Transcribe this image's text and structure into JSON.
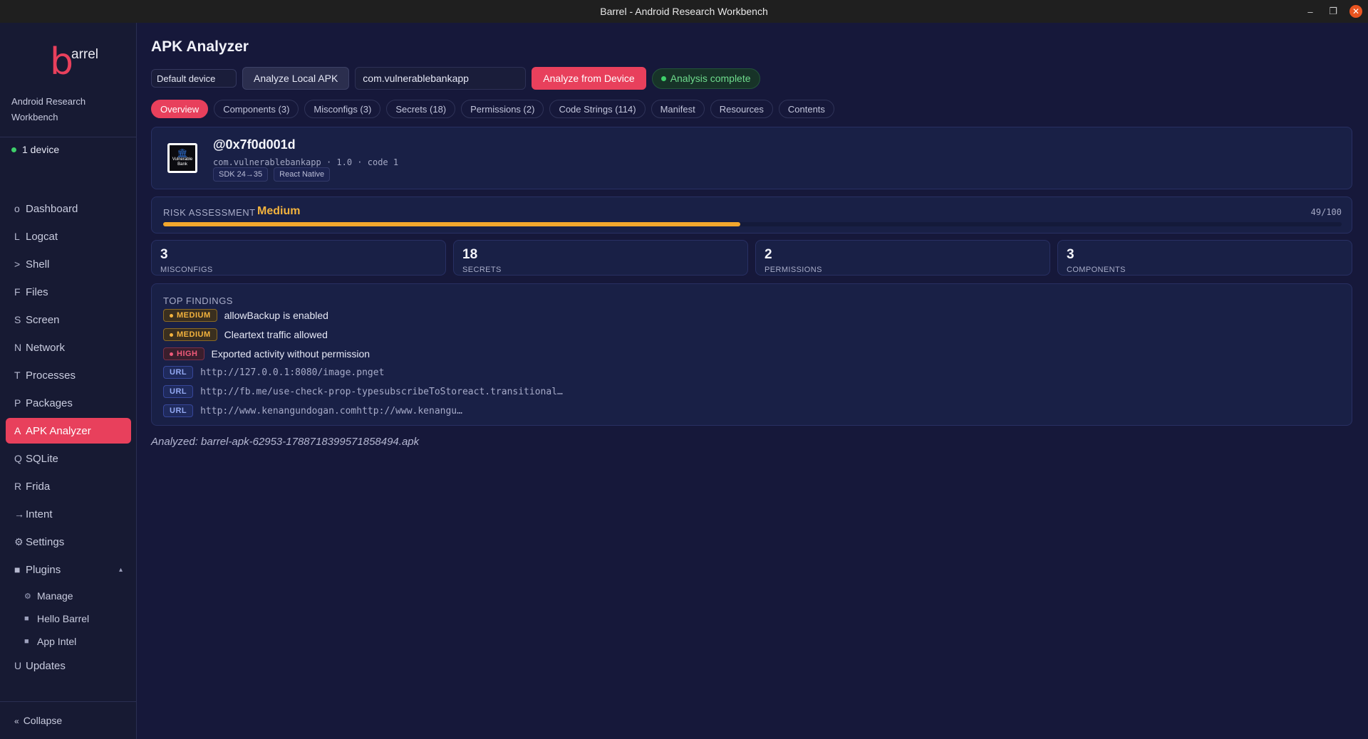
{
  "window": {
    "title": "Barrel - Android Research Workbench",
    "controls": {
      "minimize": "–",
      "restore": "❐",
      "close": "✕"
    }
  },
  "sidebar": {
    "logo_b": "b",
    "logo_text": "arrel",
    "subtitle": "Android Research Workbench",
    "device_status": "1 device",
    "nav": [
      {
        "key": "o",
        "label": "Dashboard"
      },
      {
        "key": "L",
        "label": "Logcat"
      },
      {
        "key": ">",
        "label": "Shell"
      },
      {
        "key": "F",
        "label": "Files"
      },
      {
        "key": "S",
        "label": "Screen"
      },
      {
        "key": "N",
        "label": "Network"
      },
      {
        "key": "T",
        "label": "Processes"
      },
      {
        "key": "P",
        "label": "Packages"
      },
      {
        "key": "A",
        "label": "APK Analyzer"
      },
      {
        "key": "Q",
        "label": "SQLite"
      },
      {
        "key": "R",
        "label": "Frida"
      },
      {
        "key": "→",
        "label": "Intent"
      },
      {
        "key": "⚙",
        "label": "Settings"
      },
      {
        "key": "■",
        "label": "Plugins",
        "caret": "▴"
      }
    ],
    "plugins": [
      {
        "key": "⚙",
        "label": "Manage"
      },
      {
        "key": "■",
        "label": "Hello Barrel"
      },
      {
        "key": "■",
        "label": "App Intel"
      }
    ],
    "updates": {
      "key": "U",
      "label": "Updates"
    },
    "collapse": {
      "key": "«",
      "label": "Collapse"
    }
  },
  "main": {
    "title": "APK Analyzer",
    "toolbar": {
      "device_select": "Default device",
      "analyze_local": "Analyze Local APK",
      "package_input": "com.vulnerablebankapp",
      "analyze_device": "Analyze from Device",
      "status": "Analysis complete"
    },
    "tabs": [
      "Overview",
      "Components (3)",
      "Misconfigs (3)",
      "Secrets (18)",
      "Permissions (2)",
      "Code Strings (114)",
      "Manifest",
      "Resources",
      "Contents"
    ],
    "app": {
      "icon_text": "Vulnerable Bank",
      "name": "@0x7f0d001d",
      "meta": "com.vulnerablebankapp · 1.0 · code 1",
      "chips": [
        "SDK 24→35",
        "React Native"
      ]
    },
    "risk": {
      "label": "RISK ASSESSMENT",
      "level": "Medium",
      "score_text": "49/100",
      "score": 49
    },
    "stats": [
      {
        "value": "3",
        "label": "MISCONFIGS"
      },
      {
        "value": "18",
        "label": "SECRETS"
      },
      {
        "value": "2",
        "label": "PERMISSIONS"
      },
      {
        "value": "3",
        "label": "COMPONENTS"
      }
    ],
    "findings": {
      "title": "TOP FINDINGS",
      "items": [
        {
          "severity": "MEDIUM",
          "text": "allowBackup is enabled"
        },
        {
          "severity": "MEDIUM",
          "text": "Cleartext traffic allowed"
        },
        {
          "severity": "HIGH",
          "text": "Exported activity without permission"
        },
        {
          "severity": "URL",
          "text": "http://127.0.0.1:8080/image.pnget"
        },
        {
          "severity": "URL",
          "text": "http://fb.me/use-check-prop-typesubscribeToStoreact.transitional…"
        },
        {
          "severity": "URL",
          "text": "http://www.kenangundogan.comhttp://www.kenangu…"
        }
      ]
    },
    "analyzed": "Analyzed: barrel-apk-62953-1788718399571858494.apk"
  },
  "colors": {
    "accent": "#e8405c",
    "medium": "#f3b33d",
    "high": "#f15a7a",
    "success": "#3ecf6a",
    "background": "#16183a"
  }
}
